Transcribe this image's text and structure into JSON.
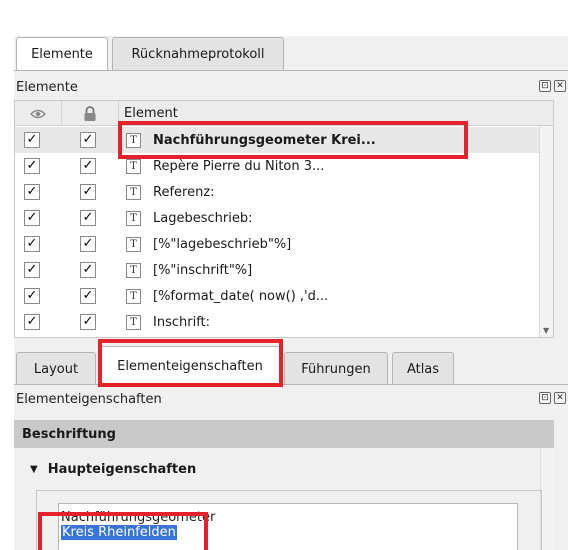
{
  "top_tabs": [
    {
      "label": "Elemente",
      "active": true
    },
    {
      "label": "Rücknahmeprotokoll",
      "active": false
    }
  ],
  "items_panel": {
    "title": "Elemente",
    "columns": {
      "visibility_icon": "eye-icon",
      "lock_icon": "lock-icon",
      "element": "Element"
    },
    "rows": [
      {
        "visible": "✓",
        "locked": "✓",
        "type_icon": "T",
        "label": "Nachführungsgeometer Krei...",
        "selected": true
      },
      {
        "visible": "✓",
        "locked": "✓",
        "type_icon": "T",
        "label": "Repère Pierre du Niton 3...",
        "selected": false
      },
      {
        "visible": "✓",
        "locked": "✓",
        "type_icon": "T",
        "label": "Referenz:",
        "selected": false
      },
      {
        "visible": "✓",
        "locked": "✓",
        "type_icon": "T",
        "label": "Lagebeschrieb:",
        "selected": false
      },
      {
        "visible": "✓",
        "locked": "✓",
        "type_icon": "T",
        "label": "[%\"lagebeschrieb\"%]",
        "selected": false
      },
      {
        "visible": "✓",
        "locked": "✓",
        "type_icon": "T",
        "label": "[%\"inschrift\"%]",
        "selected": false
      },
      {
        "visible": "✓",
        "locked": "✓",
        "type_icon": "T",
        "label": "[%format_date( now() ,'d...",
        "selected": false
      },
      {
        "visible": "✓",
        "locked": "✓",
        "type_icon": "T",
        "label": "Inschrift:",
        "selected": false
      }
    ]
  },
  "lower_tabs": [
    {
      "label": "Layout",
      "active": false
    },
    {
      "label": "Elementeigenschaften",
      "active": true
    },
    {
      "label": "Führungen",
      "active": false
    },
    {
      "label": "Atlas",
      "active": false
    }
  ],
  "properties_panel": {
    "title": "Elementeigenschaften",
    "section": "Beschriftung",
    "group": "Haupteigenschaften",
    "text_line1": "Nachführungsgeometer",
    "text_line2": "Kreis Rheinfelden"
  },
  "dock_buttons": {
    "float": "⊡",
    "close": "✕"
  },
  "colors": {
    "highlight": "#e3222a",
    "selection": "#3875d7",
    "section_header": "#c9c9c9"
  }
}
